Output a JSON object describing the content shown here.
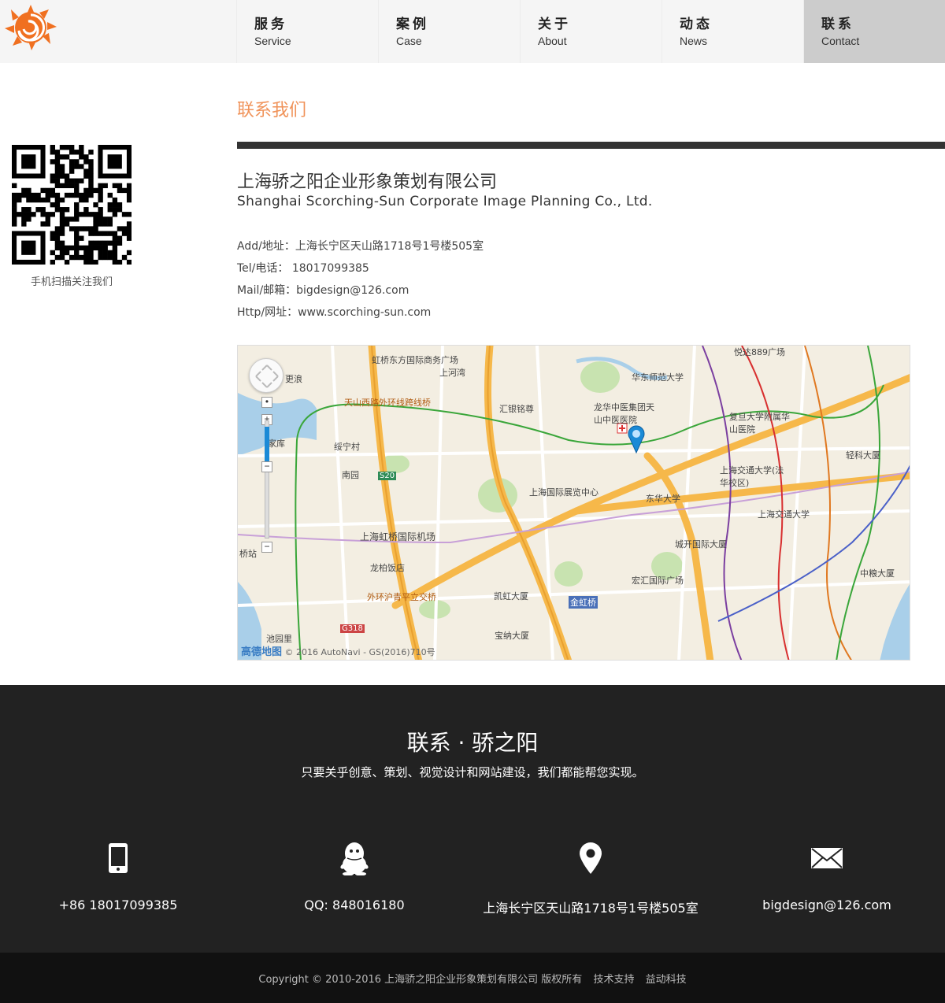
{
  "nav": {
    "items": [
      {
        "cn": "服务",
        "en": "Service"
      },
      {
        "cn": "案例",
        "en": "Case"
      },
      {
        "cn": "关于",
        "en": "About"
      },
      {
        "cn": "动态",
        "en": "News"
      },
      {
        "cn": "联系",
        "en": "Contact"
      }
    ],
    "active_index": 4,
    "logo_icon": "sun-logo-icon",
    "accent": "#f0935a"
  },
  "sidebar": {
    "qr_icon": "qr-code-icon",
    "qr_caption": "手机扫描关注我们"
  },
  "main": {
    "title": "联系我们",
    "company_cn": "上海骄之阳企业形象策划有限公司",
    "company_en": "Shanghai Scorching-Sun Corporate Image Planning Co., Ltd.",
    "info": [
      "Add/地址：上海长宁区天山路1718号1号楼505室",
      "Tel/电话： 18017099385",
      "Mail/邮箱：bigdesign@126.com",
      "Http/网址：www.scorching-sun.com"
    ]
  },
  "map": {
    "labels": {
      "l1": "虹桥东方国际商务广场",
      "l2": "上河湾",
      "l3": "悦达889广场",
      "l4": "华东师范大学",
      "l5": "汇银铭尊",
      "l6": "天山西路外环线跨线桥",
      "l7": "龙华中医集团天山中医医院",
      "l8": "复旦大学附属华山医院",
      "l9": "绥宁村",
      "l10": "南园",
      "l11": "上海国际展览中心",
      "l12": "上海交通大学(法华校区)",
      "l13": "轻科大厦",
      "l14": "东华大学",
      "l15": "上海交通大学",
      "l16": "上海虹桥国际机场",
      "l17": "城开国际大厦",
      "l18": "龙柏饭店",
      "l19": "外环沪青平立交桥",
      "l20": "凯虹大厦",
      "l21": "宏汇国际广场",
      "l22": "金虹桥",
      "l23": "宝纳大厦",
      "l24": "中粮大厦",
      "l25": "池园里",
      "l26": "S20",
      "l27": "G318",
      "l28": "桥站",
      "l29": "家库",
      "l30": "更浪"
    },
    "logo_text": "高德地图",
    "attribution": "© 2016 AutoNavi - GS(2016)710号",
    "marker_icon": "map-pin-icon"
  },
  "footer": {
    "title": "联系 · 骄之阳",
    "subtitle": "只要关乎创意、策划、视觉设计和网站建设，我们都能帮您实现。",
    "contacts": [
      {
        "icon": "mobile-phone-icon",
        "text": "+86 18017099385"
      },
      {
        "icon": "qq-penguin-icon",
        "text": "QQ: 848016180"
      },
      {
        "icon": "location-pin-icon",
        "text": "上海长宁区天山路1718号1号楼505室"
      },
      {
        "icon": "envelope-icon",
        "text": "bigdesign@126.com"
      }
    ]
  },
  "bottom": {
    "copyright": "Copyright © 2010-2016 上海骄之阳企业形象策划有限公司 版权所有",
    "support_label": "技术支持",
    "support_name": "益动科技"
  }
}
